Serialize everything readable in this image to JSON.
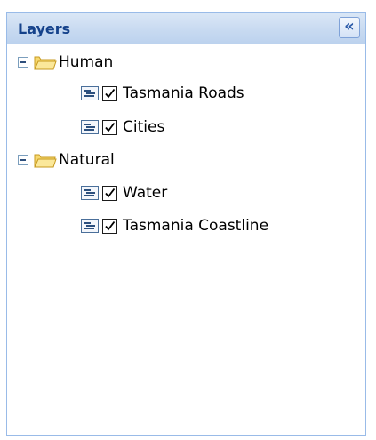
{
  "panel": {
    "title": "Layers",
    "collapse_glyph": "«"
  },
  "tree": {
    "groups": [
      {
        "label": "Human",
        "expanded": true,
        "layers": [
          {
            "label": "Tasmania Roads",
            "checked": true
          },
          {
            "label": "Cities",
            "checked": true
          }
        ]
      },
      {
        "label": "Natural",
        "expanded": true,
        "layers": [
          {
            "label": "Water",
            "checked": true
          },
          {
            "label": "Tasmania Coastline",
            "checked": true
          }
        ]
      }
    ]
  },
  "colors": {
    "header_text": "#15428b",
    "border": "#99bbe8",
    "folder_fill": "#f7d970",
    "folder_stroke": "#c79a1f"
  },
  "icons": {
    "expander": "minus-box-icon",
    "group": "folder-open-icon",
    "layer_legend": "legend-icon",
    "layer_toggle": "checkbox-checked-icon",
    "collapse": "double-chevron-left-icon"
  }
}
